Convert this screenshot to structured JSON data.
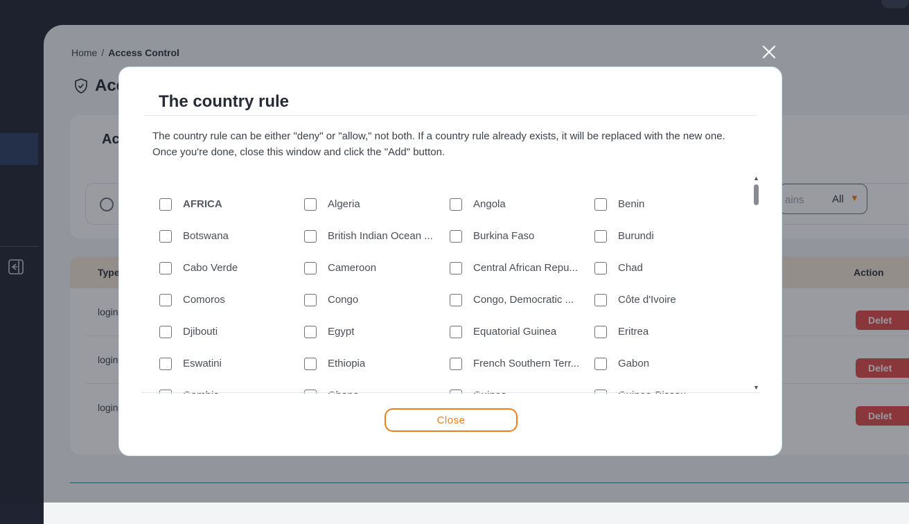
{
  "breadcrumb": {
    "home": "Home",
    "separator": "/",
    "current": "Access Control"
  },
  "page": {
    "title": "Acc"
  },
  "card1": {
    "title": "Ac",
    "domain_placeholder": "ains",
    "domain_value": "All"
  },
  "table": {
    "col_type": "Type",
    "col_action": "Action",
    "rows": [
      {
        "type": "login",
        "action": "Delet"
      },
      {
        "type": "login",
        "action": "Delet"
      },
      {
        "type": "login",
        "action": "Delet"
      }
    ]
  },
  "modal": {
    "title": "The country rule",
    "description": "The country rule can be either \"deny\" or \"allow,\" not both. If a country rule already exists, it will be replaced with the new one. Once you're done, close this window and click the \"Add\" button.",
    "close_button": "Close",
    "items": [
      {
        "label": "AFRICA",
        "region": true
      },
      {
        "label": "Algeria"
      },
      {
        "label": "Angola"
      },
      {
        "label": "Benin"
      },
      {
        "label": "Botswana"
      },
      {
        "label": "British Indian Ocean ..."
      },
      {
        "label": "Burkina Faso"
      },
      {
        "label": "Burundi"
      },
      {
        "label": "Cabo Verde"
      },
      {
        "label": "Cameroon"
      },
      {
        "label": "Central African Repu..."
      },
      {
        "label": "Chad"
      },
      {
        "label": "Comoros"
      },
      {
        "label": "Congo"
      },
      {
        "label": "Congo, Democratic ..."
      },
      {
        "label": "Côte d'Ivoire"
      },
      {
        "label": "Djibouti"
      },
      {
        "label": "Egypt"
      },
      {
        "label": "Equatorial Guinea"
      },
      {
        "label": "Eritrea"
      },
      {
        "label": "Eswatini"
      },
      {
        "label": "Ethiopia"
      },
      {
        "label": "French Southern Terr..."
      },
      {
        "label": "Gabon"
      },
      {
        "label": "Gambia"
      },
      {
        "label": "Ghana"
      },
      {
        "label": "Guinea"
      },
      {
        "label": "Guinea-Bissau"
      }
    ]
  },
  "colors": {
    "accent": "#ef7d1a",
    "danger": "#e34a4a",
    "sidebar": "#1f2332",
    "table_header": "#f6e7d8"
  }
}
